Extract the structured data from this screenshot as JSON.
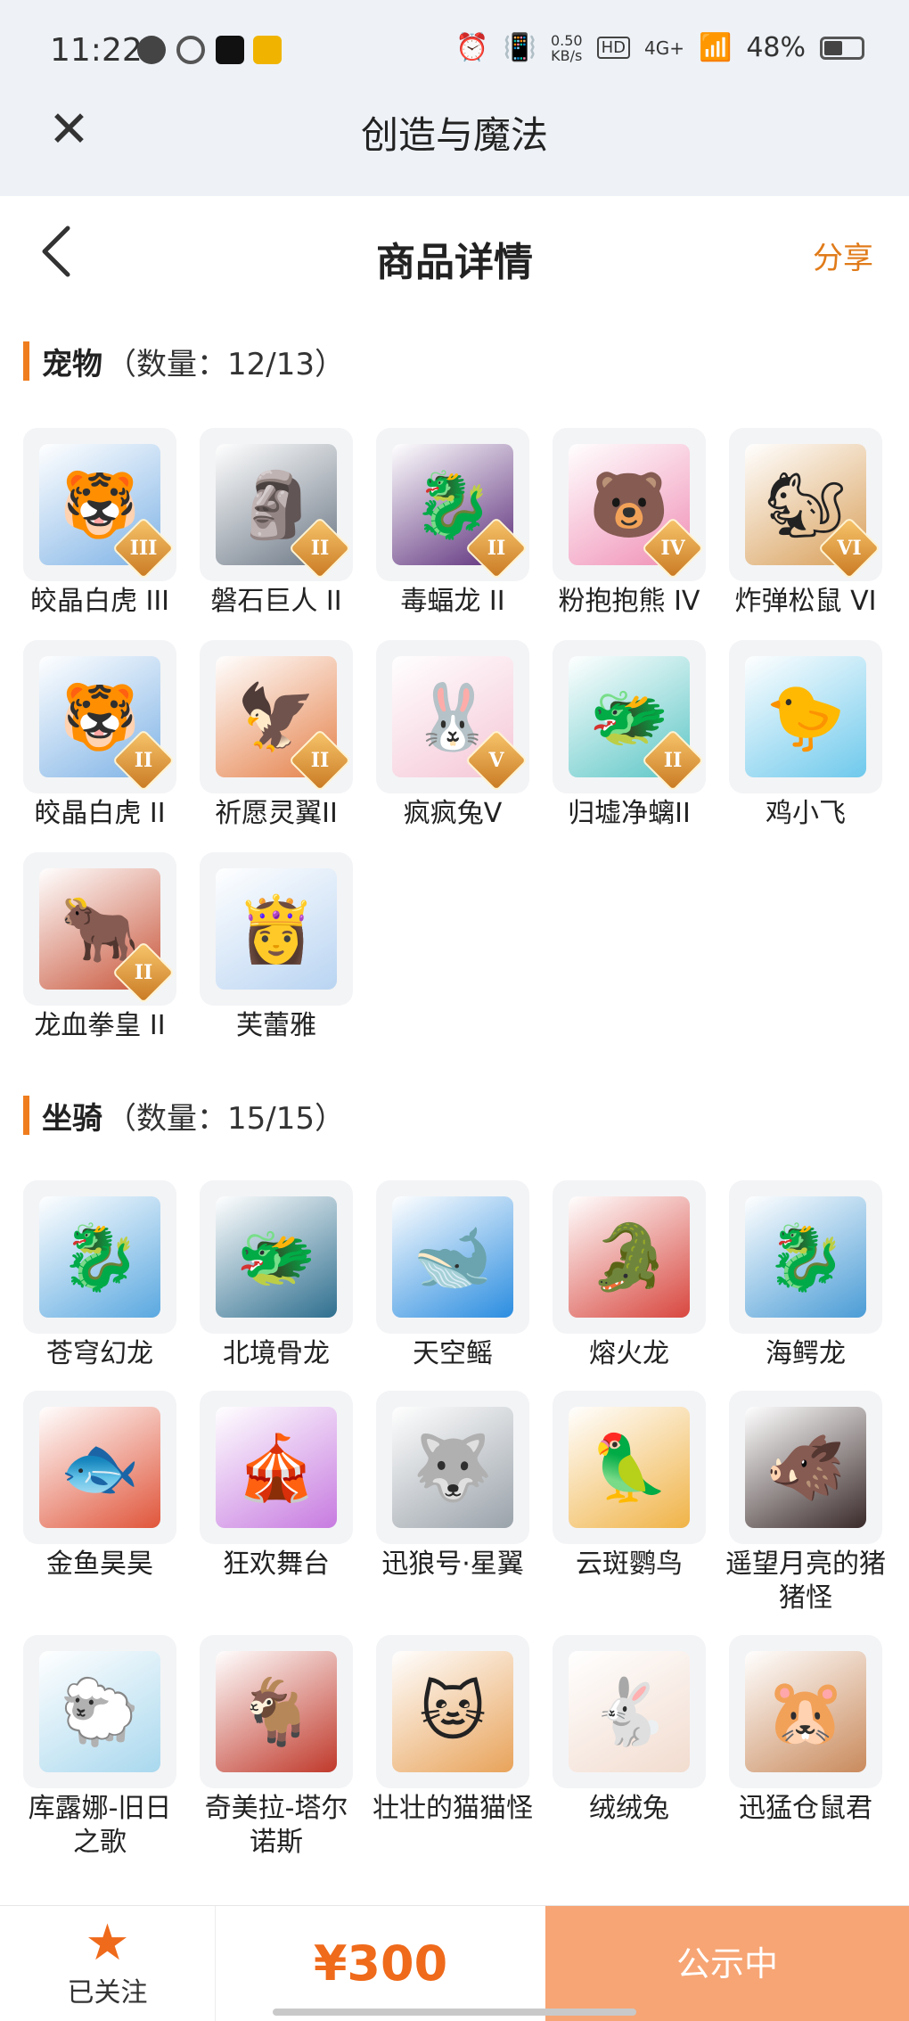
{
  "status_bar": {
    "time": "11:22",
    "net_speed_value": "0.50",
    "net_speed_unit": "KB/s",
    "hd": "HD",
    "network": "4G+",
    "battery": "48%"
  },
  "app_header": {
    "title": "创造与魔法"
  },
  "page_nav": {
    "title": "商品详情",
    "share_label": "分享"
  },
  "pets": {
    "name": "宠物",
    "count": "（数量：12/13）",
    "items": [
      {
        "label": "皎晶白虎 III",
        "rank": "III",
        "glyph": "🐯",
        "color": "#7fb3e6"
      },
      {
        "label": "磐石巨人 II",
        "rank": "II",
        "glyph": "🗿",
        "color": "#6b7785"
      },
      {
        "label": "毒蝠龙 II",
        "rank": "II",
        "glyph": "🐉",
        "color": "#5b2d7a"
      },
      {
        "label": "粉抱抱熊 IV",
        "rank": "IV",
        "glyph": "🐻",
        "color": "#f08fb5"
      },
      {
        "label": "炸弹松鼠 VI",
        "rank": "VI",
        "glyph": "🐿",
        "color": "#d9a05b"
      },
      {
        "label": "皎晶白虎 II",
        "rank": "II",
        "glyph": "🐯",
        "color": "#7fb3e6"
      },
      {
        "label": "祈愿灵翼II",
        "rank": "II",
        "glyph": "🦅",
        "color": "#e5814a"
      },
      {
        "label": "疯疯兔V",
        "rank": "V",
        "glyph": "🐰",
        "color": "#f5c6d6"
      },
      {
        "label": "归墟净螭II",
        "rank": "II",
        "glyph": "🐲",
        "color": "#5cc6c6"
      },
      {
        "label": "鸡小飞",
        "rank": "",
        "glyph": "🐤",
        "color": "#6ec9ec"
      },
      {
        "label": "龙血拳皇 II",
        "rank": "II",
        "glyph": "🐂",
        "color": "#c8553a"
      },
      {
        "label": "芙蕾雅",
        "rank": "",
        "glyph": "👸",
        "color": "#b9d4f2"
      }
    ]
  },
  "mounts": {
    "name": "坐骑",
    "count": "（数量：15/15）",
    "items": [
      {
        "label": "苍穹幻龙",
        "glyph": "🐉",
        "color": "#5aa8e0"
      },
      {
        "label": "北境骨龙",
        "glyph": "🐲",
        "color": "#2f6f8f"
      },
      {
        "label": "天空鳐",
        "glyph": "🐋",
        "color": "#2b8de0"
      },
      {
        "label": "熔火龙",
        "glyph": "🐊",
        "color": "#d8473f"
      },
      {
        "label": "海鳄龙",
        "glyph": "🐉",
        "color": "#4a9cd6"
      },
      {
        "label": "金鱼昊昊",
        "glyph": "🐟",
        "color": "#e0553a"
      },
      {
        "label": "狂欢舞台",
        "glyph": "🎪",
        "color": "#c77be0"
      },
      {
        "label": "迅狼号·星翼",
        "glyph": "🐺",
        "color": "#9aa2aa"
      },
      {
        "label": "云斑鹦鸟",
        "glyph": "🦜",
        "color": "#f0b347"
      },
      {
        "label": "遥望月亮的猪猪怪",
        "glyph": "🐗",
        "color": "#3a2a2a"
      },
      {
        "label": "库露娜-旧日之歌",
        "glyph": "🐑",
        "color": "#a9d8ee"
      },
      {
        "label": "奇美拉-塔尔诺斯",
        "glyph": "🐐",
        "color": "#c0392b"
      },
      {
        "label": "壮壮的猫猫怪",
        "glyph": "🐱",
        "color": "#e8a35a"
      },
      {
        "label": "绒绒兔",
        "glyph": "🐇",
        "color": "#f2dccf"
      },
      {
        "label": "迅猛仓鼠君",
        "glyph": "🐹",
        "color": "#c98a5c"
      }
    ]
  },
  "bottom_bar": {
    "follow_label": "已关注",
    "price": "¥300",
    "status_label": "公示中"
  }
}
